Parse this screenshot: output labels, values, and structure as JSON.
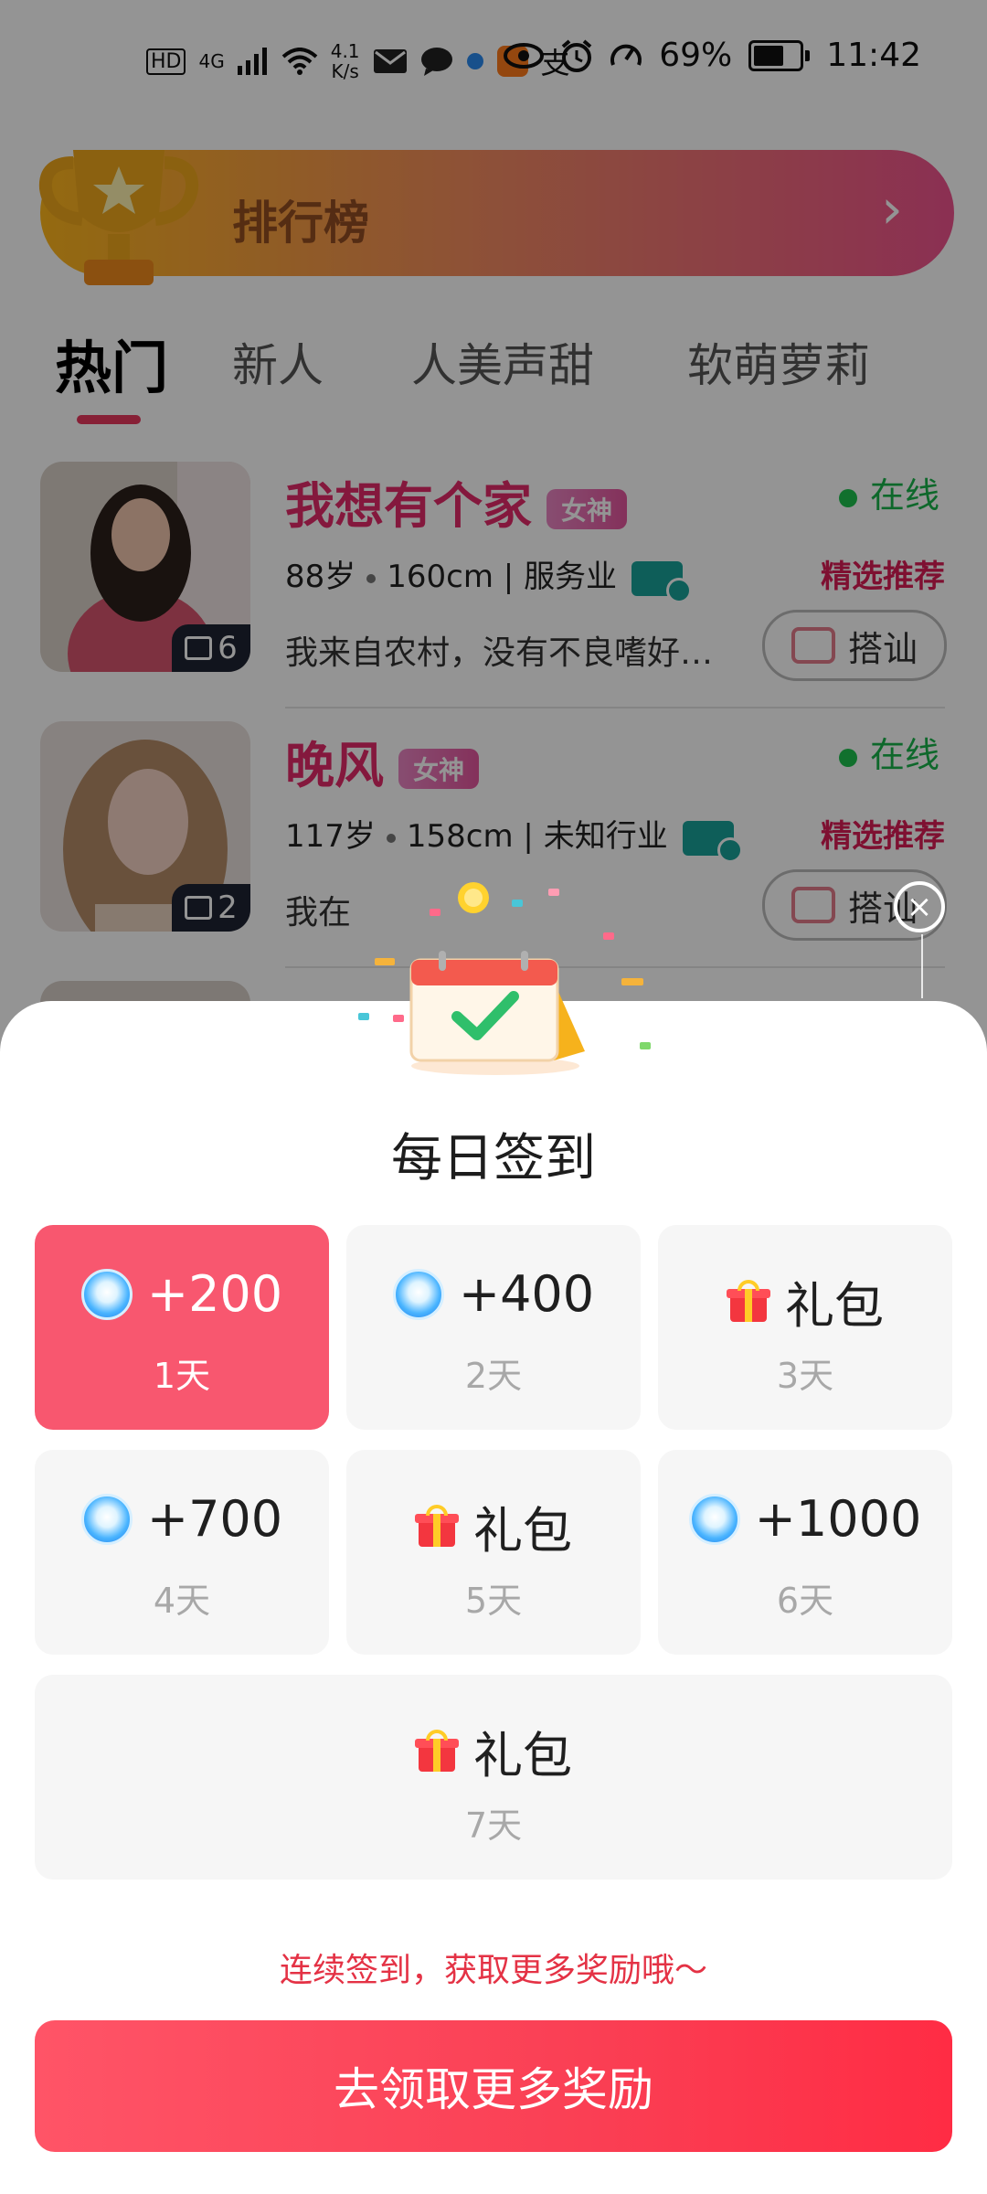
{
  "status_bar": {
    "hd": "HD",
    "network": "4G",
    "speed_value": "4.1",
    "speed_unit": "K/s",
    "battery": "69%",
    "time": "11:42"
  },
  "ranking": {
    "label": "排行榜"
  },
  "tabs": [
    {
      "label": "热门",
      "active": true
    },
    {
      "label": "新人",
      "active": false
    },
    {
      "label": "人美声甜",
      "active": false
    },
    {
      "label": "软萌萝莉",
      "active": false
    }
  ],
  "users": [
    {
      "name": "我想有个家",
      "badge": "女神",
      "status": "在线",
      "age": "88岁",
      "height": "160cm",
      "job": "服务业",
      "recommend": "精选推荐",
      "desc": "我来自农村，没有不良嗜好…",
      "photo_count": "6",
      "chat_label": "搭讪"
    },
    {
      "name": "晚风",
      "badge": "女神",
      "status": "在线",
      "age": "117岁",
      "height": "158cm",
      "job": "未知行业",
      "recommend": "精选推荐",
      "desc": "我在",
      "photo_count": "2",
      "chat_label": "搭讪"
    }
  ],
  "checkin": {
    "title": "每日签到",
    "days": [
      {
        "reward": "+200",
        "day": "1天",
        "icon": "coin-icon",
        "active": true
      },
      {
        "reward": "+400",
        "day": "2天",
        "icon": "coin-icon",
        "active": false
      },
      {
        "reward": "礼包",
        "day": "3天",
        "icon": "gift-icon",
        "active": false
      },
      {
        "reward": "+700",
        "day": "4天",
        "icon": "coin-icon",
        "active": false
      },
      {
        "reward": "礼包",
        "day": "5天",
        "icon": "gift-icon",
        "active": false
      },
      {
        "reward": "+1000",
        "day": "6天",
        "icon": "coin-icon",
        "active": false
      },
      {
        "reward": "礼包",
        "day": "7天",
        "icon": "gift-icon",
        "active": false
      }
    ],
    "hint": "连续签到，获取更多奖励哦～",
    "button": "去领取更多奖励",
    "close": "×"
  },
  "colors": {
    "accent": "#f8576f",
    "button": "#fa3f54",
    "hint": "#e43245",
    "online": "#19b34a",
    "name": "#e42a6a"
  }
}
